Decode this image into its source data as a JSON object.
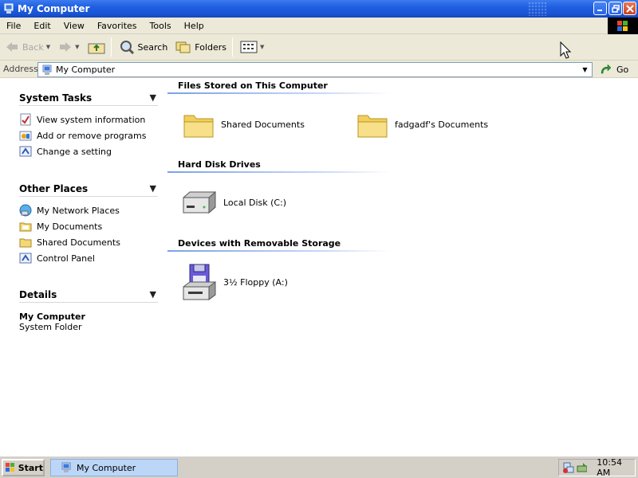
{
  "window": {
    "title": "My Computer"
  },
  "menu": [
    "File",
    "Edit",
    "View",
    "Favorites",
    "Tools",
    "Help"
  ],
  "toolbar": {
    "back": "Back",
    "search": "Search",
    "folders": "Folders"
  },
  "address": {
    "label": "Address",
    "value": "My Computer",
    "go": "Go"
  },
  "left_pane": {
    "system_tasks": {
      "title": "System Tasks",
      "items": [
        "View system information",
        "Add or remove programs",
        "Change a setting"
      ]
    },
    "other_places": {
      "title": "Other Places",
      "items": [
        "My Network Places",
        "My Documents",
        "Shared Documents",
        "Control Panel"
      ]
    },
    "details": {
      "title": "Details",
      "name": "My Computer",
      "type": "System Folder"
    }
  },
  "groups": [
    {
      "title": "Files Stored on This Computer",
      "items": [
        "Shared Documents",
        "fadgadf's Documents"
      ]
    },
    {
      "title": "Hard Disk Drives",
      "items": [
        "Local Disk (C:)"
      ]
    },
    {
      "title": "Devices with Removable Storage",
      "items": [
        "3½ Floppy (A:)"
      ]
    }
  ],
  "taskbar": {
    "start": "Start",
    "task": "My Computer",
    "clock": "10:54 AM"
  },
  "colors": {
    "titlebar": "#1f5fe0",
    "taskbar": "#d4d0c8",
    "toolbar": "#ece9d8",
    "task_active": "#bcd6f7"
  }
}
